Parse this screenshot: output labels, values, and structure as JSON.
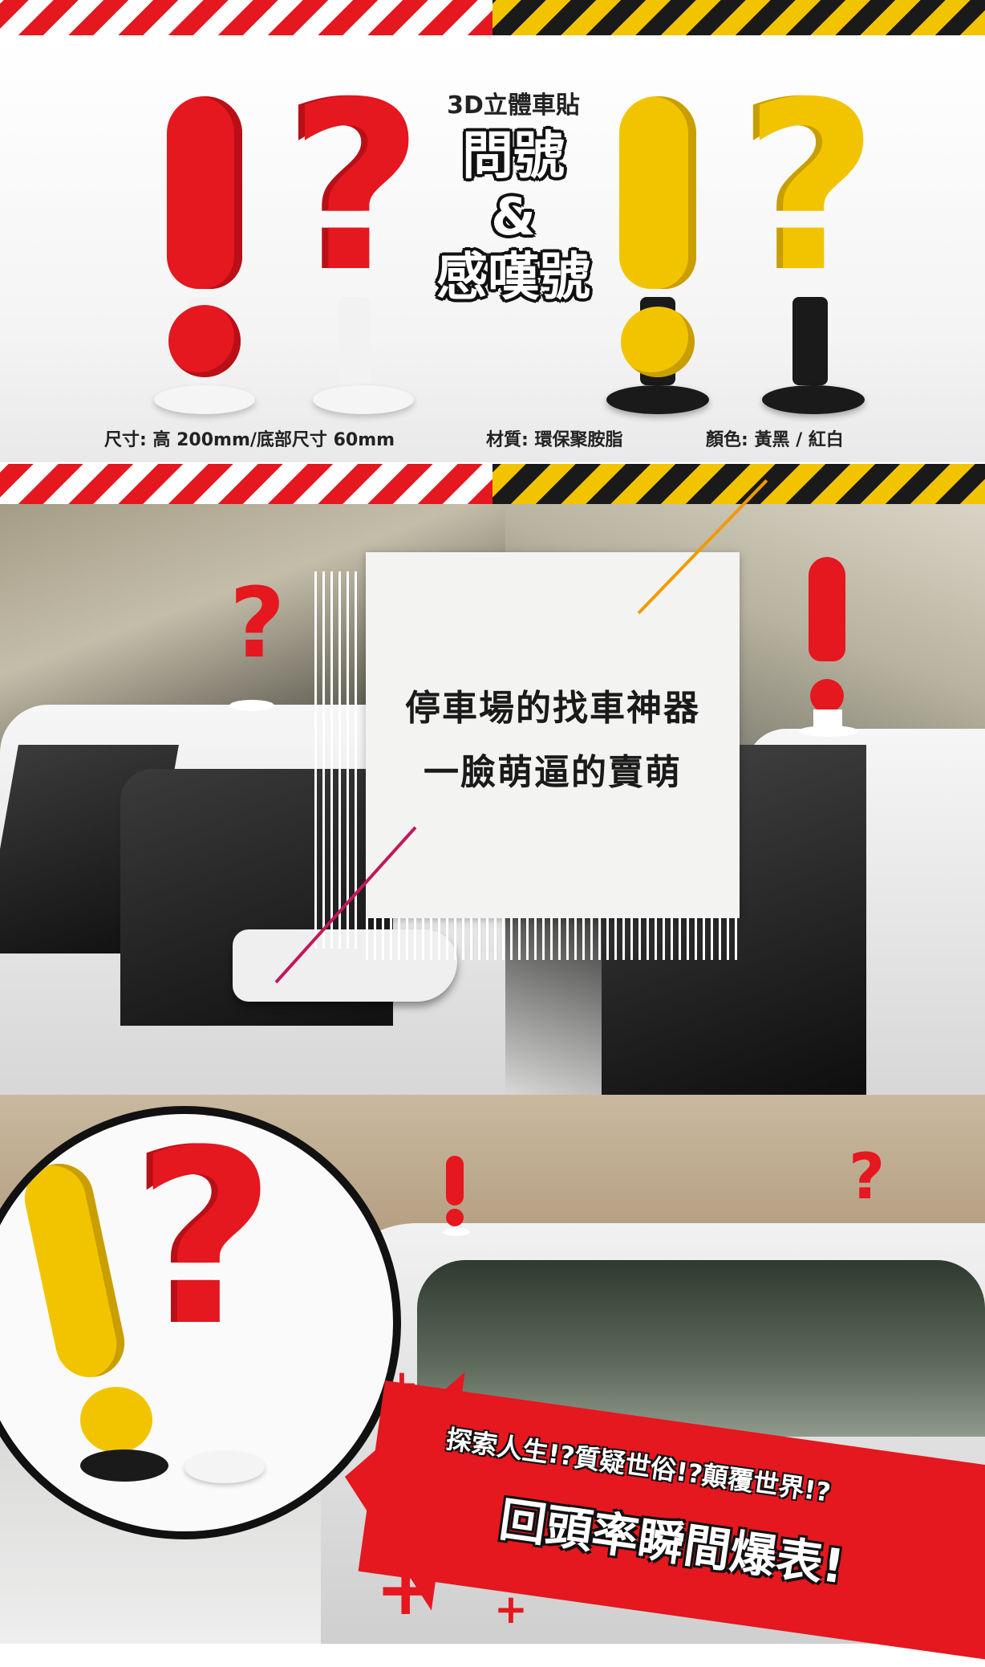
{
  "header": {
    "subtitle": "3D立體車貼",
    "title_line1": "問號",
    "title_amp": "&",
    "title_line2": "感嘆號"
  },
  "specs": {
    "size": "尺寸: 高 200mm/底部尺寸 60mm",
    "material": "材質: 環保聚胺脂",
    "color": "顏色: 黃黑 / 紅白"
  },
  "marks": {
    "exclaim": "!",
    "question": "?"
  },
  "card": {
    "line1": "停車場的找車神器",
    "line2": "一臉萌逼的賣萌"
  },
  "banner": {
    "line1": "探索人生!?質疑世俗!?顛覆世界!?",
    "line2": "回頭率瞬間爆表!"
  },
  "colors": {
    "red": "#e5171f",
    "yellow": "#f2c400",
    "black": "#1a1a1a"
  }
}
